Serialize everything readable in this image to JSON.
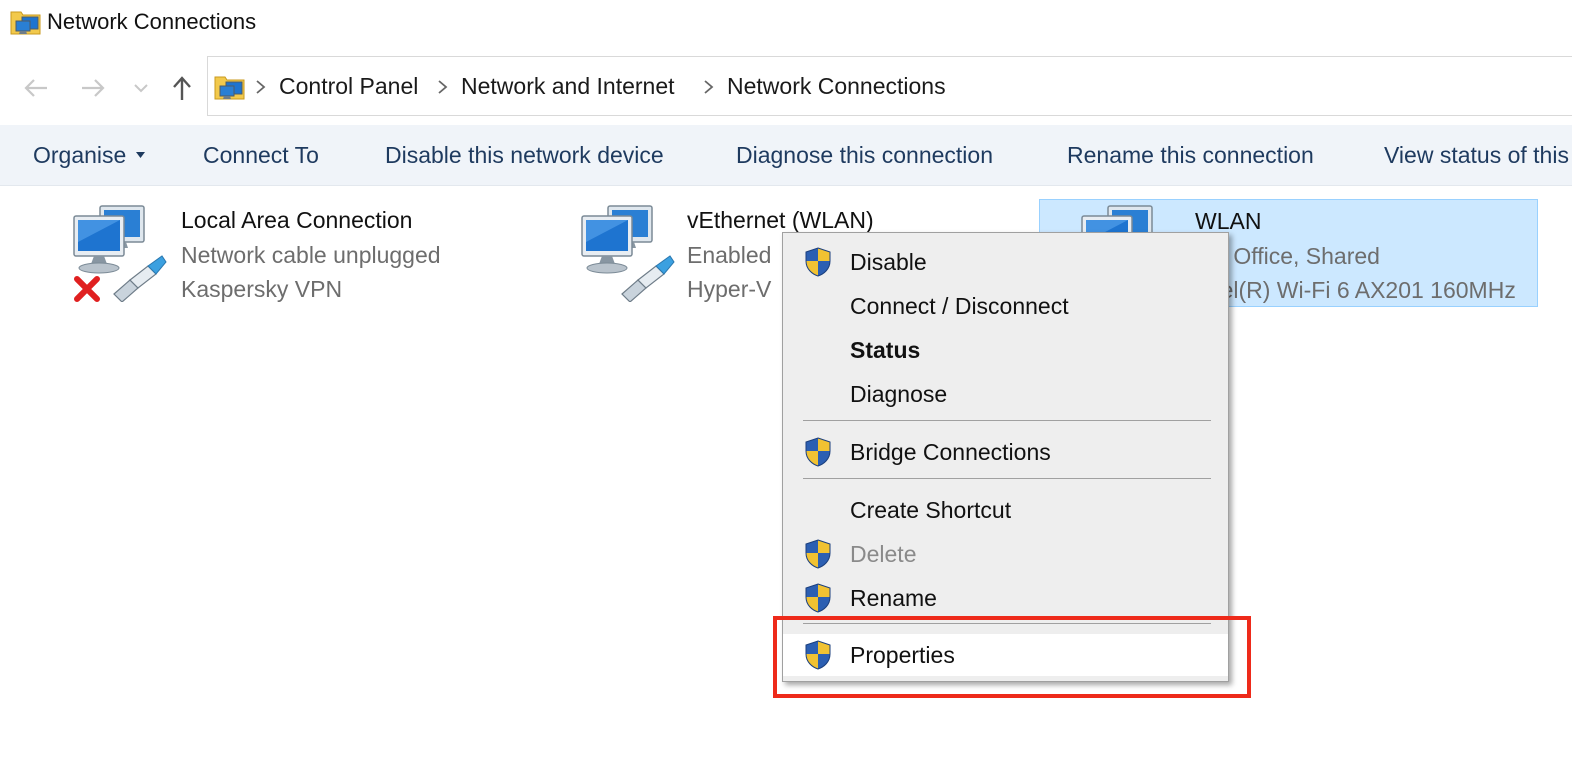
{
  "window": {
    "title": "Network Connections"
  },
  "navigation": {
    "breadcrumb": [
      "Control Panel",
      "Network and Internet",
      "Network Connections"
    ]
  },
  "commandbar": {
    "organise": "Organise",
    "connect_to": "Connect To",
    "disable": "Disable this network device",
    "diagnose": "Diagnose this connection",
    "rename": "Rename this connection",
    "view_status": "View status of this connection"
  },
  "connections": [
    {
      "name": "Local Area Connection",
      "status": "Network cable unplugged",
      "device": "Kaspersky VPN",
      "state": "disconnected"
    },
    {
      "name": "vEthernet (WLAN)",
      "status": "Enabled",
      "device": "Hyper-V",
      "state": "enabled"
    },
    {
      "name": "WLAN",
      "status": "UX Office, Shared",
      "device": "Intel(R) Wi-Fi 6 AX201 160MHz",
      "state": "selected"
    }
  ],
  "context_menu": {
    "items": [
      {
        "label": "Disable",
        "shield": true
      },
      {
        "label": "Connect / Disconnect",
        "shield": false
      },
      {
        "label": "Status",
        "shield": false,
        "bold": true
      },
      {
        "label": "Diagnose",
        "shield": false
      },
      {
        "label": "Bridge Connections",
        "shield": true
      },
      {
        "label": "Create Shortcut",
        "shield": false
      },
      {
        "label": "Delete",
        "shield": true,
        "disabled": true
      },
      {
        "label": "Rename",
        "shield": true
      },
      {
        "label": "Properties",
        "shield": true,
        "hovered": true
      }
    ]
  },
  "colors": {
    "selection_bg": "#cce8ff",
    "command_text": "#1e3a5f",
    "highlight_box": "#ee2a1a",
    "menu_bg": "#eeeeee"
  },
  "icons": {
    "title": "network-folder-icon",
    "back": "arrow-left-icon",
    "forward": "arrow-right-icon",
    "recent": "chevron-down-icon",
    "up": "arrow-up-icon",
    "connection": "network-computers-icon",
    "unplugged": "red-x-icon",
    "uac": "uac-shield-icon"
  }
}
